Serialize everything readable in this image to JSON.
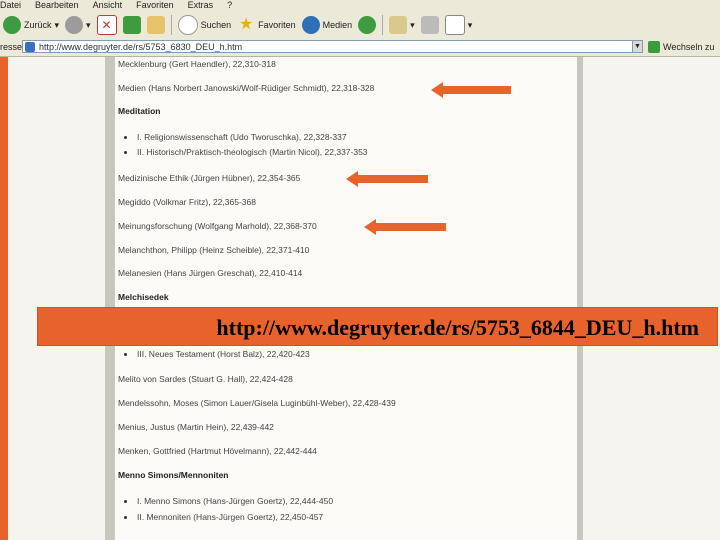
{
  "menu": [
    "Datei",
    "Bearbeiten",
    "Ansicht",
    "Favoriten",
    "Extras",
    "?"
  ],
  "toolbar": {
    "back": "Zurück",
    "search": "Suchen",
    "favorites": "Favoriten",
    "media": "Medien"
  },
  "address": {
    "label": "resse",
    "url": "http://www.degruyter.de/rs/5753_6830_DEU_h.htm",
    "go": "Wechseln zu"
  },
  "entries": [
    {
      "text": "Mecklenburg (Gert Haendler), 22,310-318"
    },
    {
      "text": "Medien (Hans Norbert Janowski/Wolf-Rüdiger Schmidt), 22,318-328"
    },
    {
      "text": "Meditation"
    },
    {
      "text": "Medizinische Ethik (Jürgen Hübner), 22,354-365"
    },
    {
      "text": "Megiddo (Volkmar Fritz), 22,365-368"
    },
    {
      "text": "Meinungsforschung (Wolfgang Marhold), 22,368-370"
    },
    {
      "text": "Melanchthon, Philipp (Heinz Scheible), 22,371-410"
    },
    {
      "text": "Melanesien (Hans Jürgen Greschat), 22,410-414"
    },
    {
      "text": "Melchisedek"
    },
    {
      "text": "Melito von Sardes (Stuart G. Hall), 22,424-428"
    },
    {
      "text": "Mendelssohn, Moses (Simon Lauer/Gisela Luginbühl-Weber), 22,428-439"
    },
    {
      "text": "Menius, Justus (Martin Hein), 22,439-442"
    },
    {
      "text": "Menken, Gottfried (Hartmut Hövelmann), 22,442-444"
    },
    {
      "text": "Menno Simons/Mennoniten"
    }
  ],
  "subentries": [
    {
      "text": "I. Religionswissenschaft (Udo Tworuschka), 22,328-337"
    },
    {
      "text": "II. Historisch/Praktisch-theologisch (Martin Nicol), 22,337-353"
    },
    {
      "text": "III. Neues Testament (Horst Balz), 22,420-423"
    },
    {
      "text": "I. Menno Simons (Hans-Jürgen Goertz), 22,444-450"
    },
    {
      "text": "II. Mennoniten (Hans-Jürgen Goertz), 22,450-457"
    }
  ],
  "banner": "http://www.degruyter.de/rs/5753_6844_DEU_h.htm"
}
